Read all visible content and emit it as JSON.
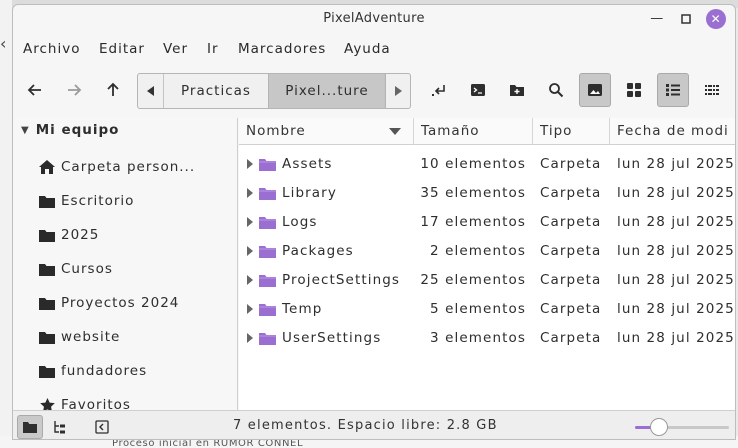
{
  "window": {
    "title": "PixelAdventure"
  },
  "menu": [
    "Archivo",
    "Editar",
    "Ver",
    "Ir",
    "Marcadores",
    "Ayuda"
  ],
  "breadcrumbs": [
    "Practicas",
    "Pixel...ture"
  ],
  "sidebar": {
    "header": "Mi equipo",
    "items": [
      {
        "label": "Carpeta person...",
        "icon": "home-icon"
      },
      {
        "label": "Escritorio",
        "icon": "folder-icon"
      },
      {
        "label": "2025",
        "icon": "folder-icon"
      },
      {
        "label": "Cursos",
        "icon": "folder-icon"
      },
      {
        "label": "Proyectos 2024",
        "icon": "folder-icon"
      },
      {
        "label": "website",
        "icon": "folder-icon"
      },
      {
        "label": "fundadores",
        "icon": "folder-icon"
      },
      {
        "label": "Favoritos",
        "icon": "star-icon"
      }
    ]
  },
  "columns": {
    "name": "Nombre",
    "size": "Tamaño",
    "type": "Tipo",
    "date": "Fecha de modi"
  },
  "files": [
    {
      "name": "Assets",
      "size": "10 elementos",
      "type": "Carpeta",
      "date": "lun 28 jul 2025"
    },
    {
      "name": "Library",
      "size": "35 elementos",
      "type": "Carpeta",
      "date": "lun 28 jul 2025"
    },
    {
      "name": "Logs",
      "size": "17 elementos",
      "type": "Carpeta",
      "date": "lun 28 jul 2025"
    },
    {
      "name": "Packages",
      "size": "2 elementos",
      "type": "Carpeta",
      "date": "lun 28 jul 2025"
    },
    {
      "name": "ProjectSettings",
      "size": "25 elementos",
      "type": "Carpeta",
      "date": "lun 28 jul 2025"
    },
    {
      "name": "Temp",
      "size": "5 elementos",
      "type": "Carpeta",
      "date": "lun 28 jul 2025"
    },
    {
      "name": "UserSettings",
      "size": "3 elementos",
      "type": "Carpeta",
      "date": "lun 28 jul 2025"
    }
  ],
  "status": {
    "text": "7 elementos. Espacio libre: 2.8 GB",
    "zoom_fraction": 0.2
  },
  "background": {
    "bottom_text": "Proceso inicial en RUMOR CONNEL"
  },
  "colors": {
    "accent": "#9b6fd2",
    "folder": "#9b6fd2"
  }
}
